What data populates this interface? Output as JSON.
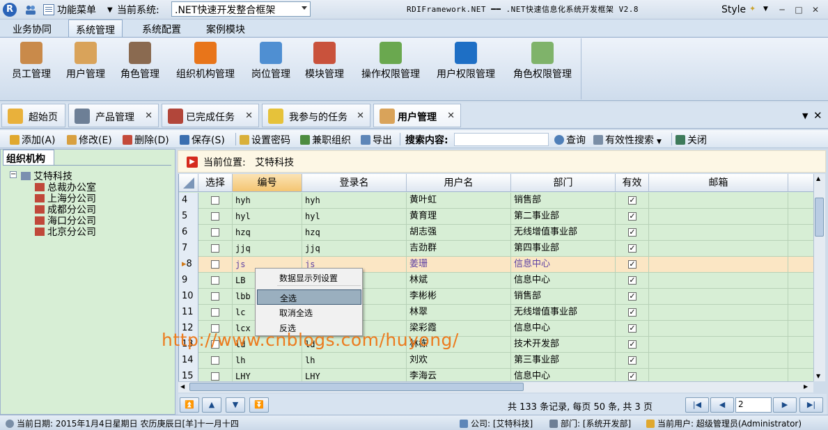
{
  "titlebar": {
    "logo": "R",
    "menu_label": "功能菜单",
    "system_label": "当前系统:",
    "system_value": ".NET快速开发整合框架",
    "app_title": "RDIFramework.NET ━━ .NET快速信息化系统开发框架 V2.8",
    "style_label": "Style"
  },
  "ribbon_tabs": [
    "业务协同",
    "系统管理",
    "系统配置",
    "案例模块"
  ],
  "ribbon_buttons": [
    {
      "label": "员工管理",
      "color": "#c98a4a"
    },
    {
      "label": "用户管理",
      "color": "#d9a35a"
    },
    {
      "label": "角色管理",
      "color": "#8a6a50"
    },
    {
      "label": "组织机构管理",
      "color": "#e8751a"
    },
    {
      "label": "岗位管理",
      "color": "#4f8fd2"
    },
    {
      "label": "模块管理",
      "color": "#c9523c"
    },
    {
      "label": "操作权限管理",
      "color": "#6aa84f"
    },
    {
      "label": "用户权限管理",
      "color": "#1e6fc5"
    },
    {
      "label": "角色权限管理",
      "color": "#7fb36a"
    }
  ],
  "doc_tabs": [
    {
      "label": "超始页",
      "closable": false,
      "color": "#e9b13b"
    },
    {
      "label": "产品管理",
      "closable": true,
      "color": "#6d7f96"
    },
    {
      "label": "已完成任务",
      "closable": true,
      "color": "#b2463a"
    },
    {
      "label": "我参与的任务",
      "closable": true,
      "color": "#e6c23a"
    },
    {
      "label": "用户管理",
      "closable": true,
      "color": "#d9a35a"
    }
  ],
  "toolbar": {
    "add": "添加(A)",
    "edit": "修改(E)",
    "delete": "删除(D)",
    "save": "保存(S)",
    "setpwd": "设置密码",
    "parttime": "兼职组织",
    "export": "导出",
    "search_label": "搜索内容:",
    "query": "查询",
    "validity": "有效性搜索",
    "close": "关闭"
  },
  "left": {
    "tab": "组织机构",
    "root": "艾特科技",
    "children": [
      "总裁办公室",
      "上海分公司",
      "成都分公司",
      "海口分公司",
      "北京分公司"
    ]
  },
  "location": {
    "label": "当前位置:",
    "value": "艾特科技"
  },
  "grid": {
    "headers": [
      "选择",
      "编号",
      "登录名",
      "用户名",
      "部门",
      "有效",
      "邮箱"
    ],
    "rows": [
      {
        "n": "4",
        "code": "hyh",
        "login": "hyh",
        "name": "黄叶虹",
        "dept": "销售部"
      },
      {
        "n": "5",
        "code": "hyl",
        "login": "hyl",
        "name": "黄育理",
        "dept": "第二事业部"
      },
      {
        "n": "6",
        "code": "hzq",
        "login": "hzq",
        "name": "胡志强",
        "dept": "无线增值事业部"
      },
      {
        "n": "7",
        "code": "jjq",
        "login": "jjq",
        "name": "吉劲群",
        "dept": "第四事业部"
      },
      {
        "n": "8",
        "code": "js",
        "login": "js",
        "name": "姜珊",
        "dept": "信息中心"
      },
      {
        "n": "9",
        "code": "LB",
        "login": "",
        "name": "林斌",
        "dept": "信息中心"
      },
      {
        "n": "10",
        "code": "lbb",
        "login": "",
        "name": "李彬彬",
        "dept": "销售部"
      },
      {
        "n": "11",
        "code": "lc",
        "login": "",
        "name": "林翠",
        "dept": "无线增值事业部"
      },
      {
        "n": "12",
        "code": "lcx",
        "login": "",
        "name": "梁彩霞",
        "dept": "信息中心"
      },
      {
        "n": "13",
        "code": "ld",
        "login": "ld",
        "name": "林栋",
        "dept": "技术开发部"
      },
      {
        "n": "14",
        "code": "lh",
        "login": "lh",
        "name": "刘欢",
        "dept": "第三事业部"
      },
      {
        "n": "15",
        "code": "LHY",
        "login": "LHY",
        "name": "李海云",
        "dept": "信息中心"
      }
    ]
  },
  "context_menu": [
    "数据显示列设置",
    "全选",
    "取消全选",
    "反选"
  ],
  "watermark": "http://www.cnblogs.com/huyong/",
  "pager": {
    "info": "共 133 条记录, 每页 50 条, 共 3 页",
    "page": "2"
  },
  "status": {
    "date": "当前日期: 2015年1月4日星期日 农历庚辰日[羊]十一月十四",
    "company": "公司: [艾特科技]",
    "dept": "部门: [系统开发部]",
    "user": "当前用户: 超级管理员(Administrator)"
  }
}
